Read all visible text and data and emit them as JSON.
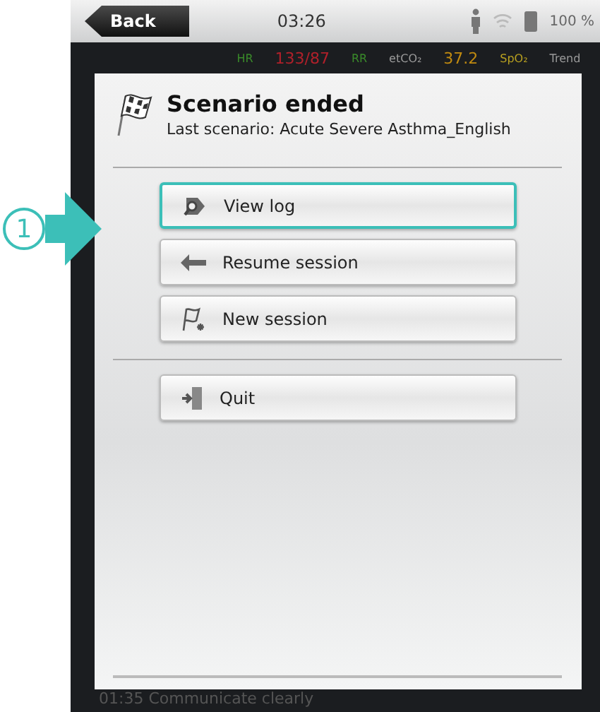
{
  "callout": {
    "number": "1"
  },
  "status_bar": {
    "back_button": "Back",
    "time": "03:26",
    "battery": "100 %"
  },
  "vitals": [
    {
      "text": "HR",
      "kind": "label",
      "color": "#3a8a2a"
    },
    {
      "text": "133/87",
      "kind": "value",
      "color": "#b0202a"
    },
    {
      "text": "RR",
      "kind": "label",
      "color": "#3a8a2a"
    },
    {
      "text": "etCO₂",
      "kind": "label",
      "color": "#9a9a9a"
    },
    {
      "text": "37.2",
      "kind": "value",
      "color": "#c08a10"
    },
    {
      "text": "SpO₂",
      "kind": "label",
      "color": "#b8a020"
    },
    {
      "text": "Trend",
      "kind": "label",
      "color": "#9a9a9a"
    }
  ],
  "dialog": {
    "title": "Scenario ended",
    "subtitle": "Last scenario: Acute Severe Asthma_English",
    "groups": [
      [
        {
          "label": "View log",
          "kind": "log",
          "selected": true
        },
        {
          "label": "Resume session",
          "kind": "resume",
          "selected": false
        },
        {
          "label": "New session",
          "kind": "new",
          "selected": false
        }
      ],
      [
        {
          "label": "Quit",
          "kind": "quit",
          "selected": false
        }
      ]
    ]
  },
  "log_line": "01:35  Communicate clearly"
}
